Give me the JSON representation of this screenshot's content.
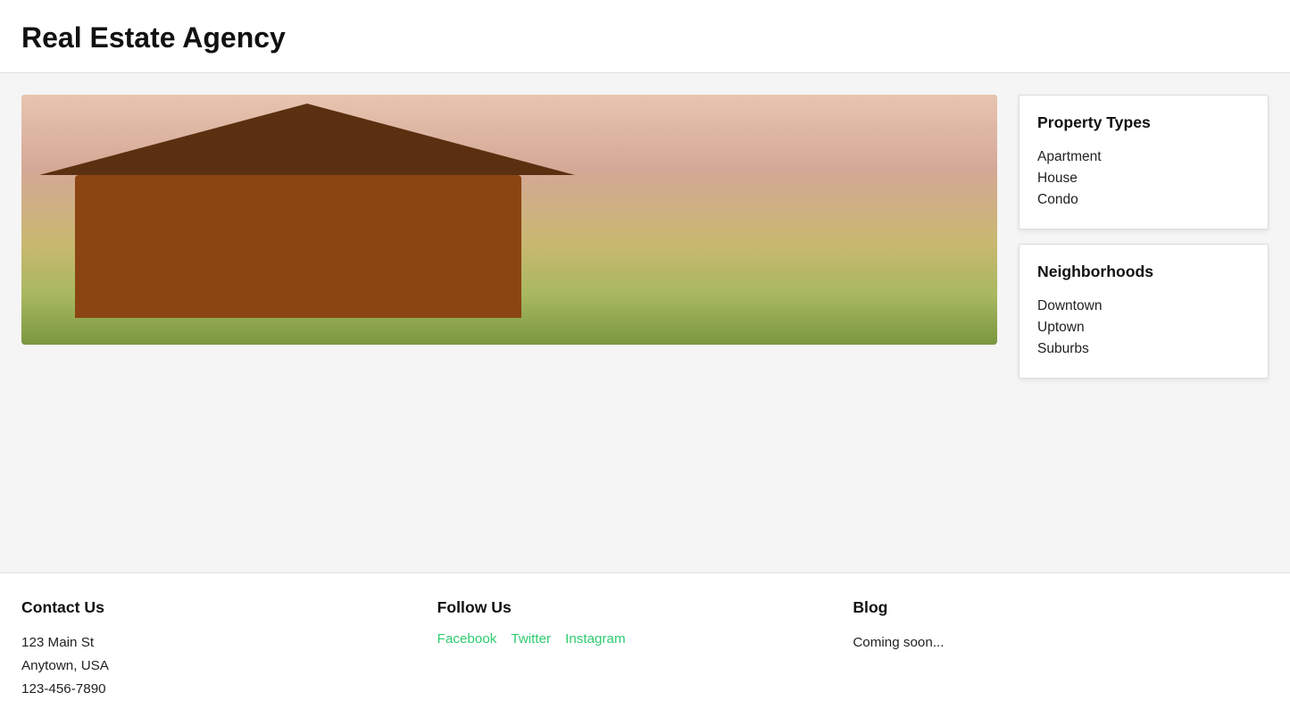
{
  "header": {
    "title": "Real Estate Agency"
  },
  "sidebar": {
    "property_types": {
      "heading": "Property Types",
      "items": [
        "Apartment",
        "House",
        "Condo"
      ]
    },
    "neighborhoods": {
      "heading": "Neighborhoods",
      "items": [
        "Downtown",
        "Uptown",
        "Suburbs"
      ]
    }
  },
  "footer": {
    "contact": {
      "heading": "Contact Us",
      "address_line1": "123 Main St",
      "address_line2": "Anytown, USA",
      "phone": "123-456-7890"
    },
    "follow": {
      "heading": "Follow Us",
      "links": [
        {
          "label": "Facebook",
          "href": "#"
        },
        {
          "label": "Twitter",
          "href": "#"
        },
        {
          "label": "Instagram",
          "href": "#"
        }
      ]
    },
    "blog": {
      "heading": "Blog",
      "coming_soon": "Coming soon..."
    }
  }
}
